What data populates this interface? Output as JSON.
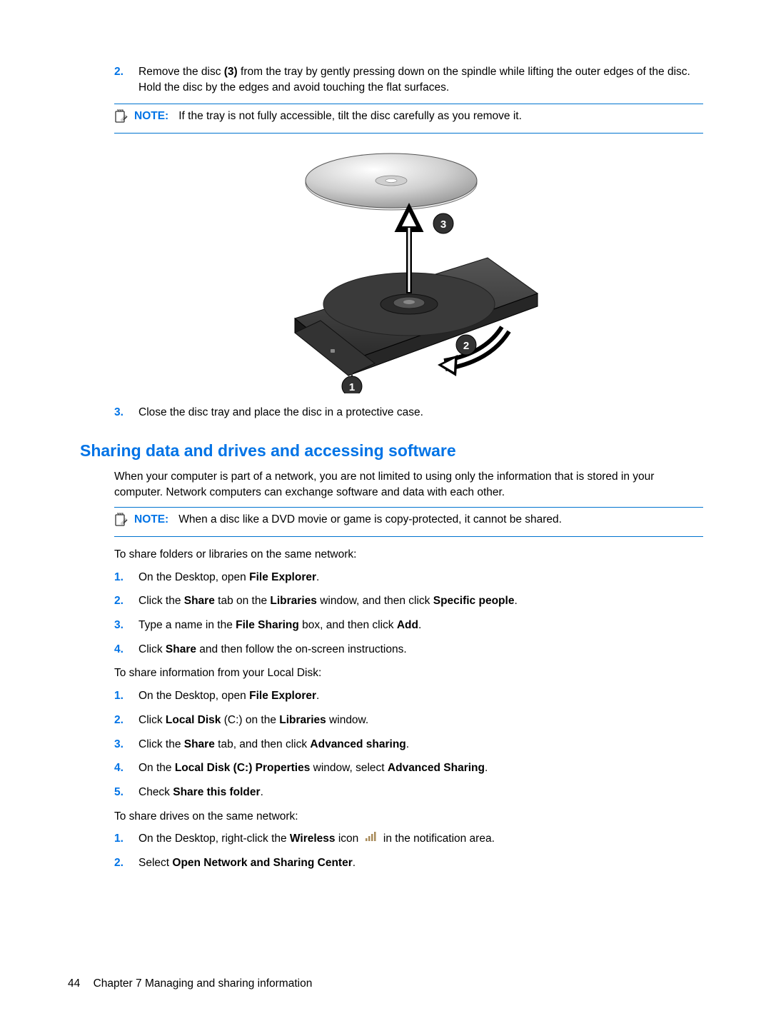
{
  "step2": {
    "num": "2.",
    "text_a": "Remove the disc ",
    "text_b": "(3)",
    "text_c": " from the tray by gently pressing down on the spindle while lifting the outer edges of the disc. Hold the disc by the edges and avoid touching the flat surfaces."
  },
  "note1": {
    "label": "NOTE:",
    "text": "If the tray is not fully accessible, tilt the disc carefully as you remove it."
  },
  "step3": {
    "num": "3.",
    "text": "Close the disc tray and place the disc in a protective case."
  },
  "heading": "Sharing data and drives and accessing software",
  "intro": "When your computer is part of a network, you are not limited to using only the information that is stored in your computer. Network computers can exchange software and data with each other.",
  "note2": {
    "label": "NOTE:",
    "text": "When a disc like a DVD movie or game is copy-protected, it cannot be shared."
  },
  "lead1": "To share folders or libraries on the same network:",
  "listA": {
    "i1": {
      "num": "1.",
      "a": "On the Desktop, open ",
      "b": "File Explorer",
      "c": "."
    },
    "i2": {
      "num": "2.",
      "a": "Click the ",
      "b": "Share",
      "c": " tab on the ",
      "d": "Libraries",
      "e": " window, and then click ",
      "f": "Specific people",
      "g": "."
    },
    "i3": {
      "num": "3.",
      "a": "Type a name in the ",
      "b": "File Sharing",
      "c": " box, and then click ",
      "d": "Add",
      "e": "."
    },
    "i4": {
      "num": "4.",
      "a": "Click ",
      "b": "Share",
      "c": " and then follow the on-screen instructions."
    }
  },
  "lead2": "To share information from your Local Disk:",
  "listB": {
    "i1": {
      "num": "1.",
      "a": "On the Desktop, open ",
      "b": "File Explorer",
      "c": "."
    },
    "i2": {
      "num": "2.",
      "a": "Click ",
      "b": "Local Disk",
      "c": " (C:) on the ",
      "d": "Libraries",
      "e": " window."
    },
    "i3": {
      "num": "3.",
      "a": "Click the ",
      "b": "Share",
      "c": " tab, and then click ",
      "d": "Advanced sharing",
      "e": "."
    },
    "i4": {
      "num": "4.",
      "a": "On the ",
      "b": "Local Disk (C:) Properties",
      "c": " window, select ",
      "d": "Advanced Sharing",
      "e": "."
    },
    "i5": {
      "num": "5.",
      "a": "Check ",
      "b": "Share this folder",
      "c": "."
    }
  },
  "lead3": "To share drives on the same network:",
  "listC": {
    "i1": {
      "num": "1.",
      "a": "On the Desktop, right-click the ",
      "b": "Wireless",
      "c": " icon ",
      "d": " in the notification area."
    },
    "i2": {
      "num": "2.",
      "a": "Select ",
      "b": "Open Network and Sharing Center",
      "c": "."
    }
  },
  "footer": {
    "page": "44",
    "chapter": "Chapter 7   Managing and sharing information"
  }
}
